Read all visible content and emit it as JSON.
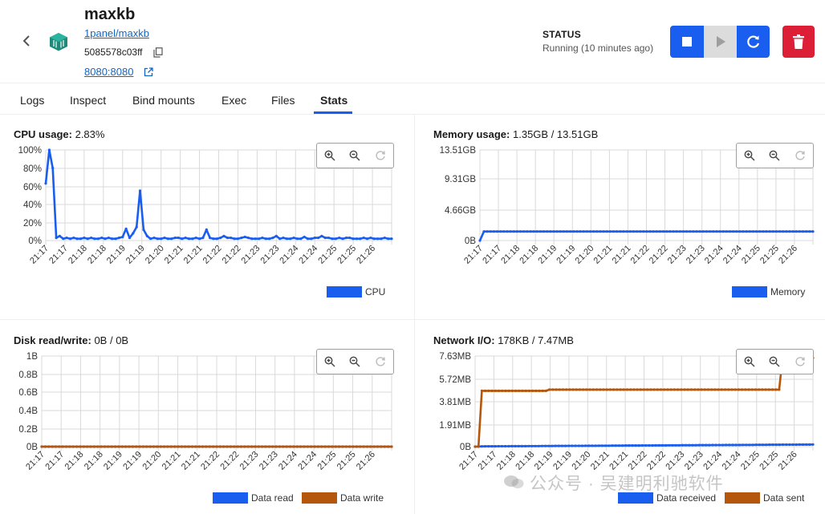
{
  "header": {
    "name": "maxkb",
    "image": "1panel/maxkb",
    "container_id": "5085578c03ff",
    "port": "8080:8080",
    "status_label": "STATUS",
    "status_value": "Running (10 minutes ago)"
  },
  "tabs": [
    {
      "label": "Logs",
      "active": false
    },
    {
      "label": "Inspect",
      "active": false
    },
    {
      "label": "Bind mounts",
      "active": false
    },
    {
      "label": "Exec",
      "active": false
    },
    {
      "label": "Files",
      "active": false
    },
    {
      "label": "Stats",
      "active": true
    }
  ],
  "colors": {
    "blue": "#1a5ef0",
    "orange": "#b5560d",
    "red": "#dc1e36",
    "grid": "#d9d9d9"
  },
  "panels": {
    "cpu": {
      "label": "CPU usage:",
      "value": "2.83%"
    },
    "memory": {
      "label": "Memory usage:",
      "value": "1.35GB / 13.51GB"
    },
    "disk": {
      "label": "Disk read/write:",
      "value": "0B / 0B"
    },
    "network": {
      "label": "Network I/O:",
      "value": "178KB / 7.47MB"
    }
  },
  "watermark": "公众号 · 吴建明利驰软件",
  "chart_data": [
    {
      "id": "cpu",
      "type": "line",
      "y_ticks": [
        "100%",
        "80%",
        "60%",
        "40%",
        "20%",
        "0%"
      ],
      "ylim": [
        0,
        100
      ],
      "x_ticks": [
        "21:17",
        "21:17",
        "21:18",
        "21:18",
        "21:19",
        "21:19",
        "21:20",
        "21:21",
        "21:21",
        "21:22",
        "21:22",
        "21:23",
        "21:23",
        "21:24",
        "21:24",
        "21:25",
        "21:25",
        "21:26"
      ],
      "series": [
        {
          "name": "CPU",
          "color": "#1a5ef0",
          "values": [
            63,
            100,
            80,
            3,
            5,
            2,
            3,
            2,
            3,
            2,
            2,
            3,
            2,
            3,
            2,
            2,
            3,
            2,
            3,
            2,
            2,
            3,
            4,
            13,
            3,
            8,
            15,
            55,
            12,
            5,
            2,
            3,
            2,
            2,
            3,
            2,
            2,
            3,
            3,
            2,
            3,
            2,
            2,
            3,
            2,
            3,
            12,
            3,
            2,
            2,
            3,
            5,
            3,
            3,
            2,
            2,
            3,
            4,
            3,
            2,
            2,
            2,
            3,
            2,
            2,
            3,
            5,
            2,
            3,
            2,
            2,
            3,
            2,
            2,
            4,
            2,
            2,
            3,
            3,
            5,
            3,
            3,
            2,
            2,
            3,
            2,
            3,
            3,
            2,
            2,
            2,
            3,
            2,
            3,
            2,
            2,
            2,
            3,
            2,
            2
          ]
        }
      ]
    },
    {
      "id": "memory",
      "type": "line",
      "y_ticks": [
        "13.51GB",
        "9.31GB",
        "4.66GB",
        "0B"
      ],
      "ylim": [
        0,
        13.51
      ],
      "x_ticks": [
        "21:17",
        "21:17",
        "21:18",
        "21:18",
        "21:19",
        "21:19",
        "21:20",
        "21:21",
        "21:21",
        "21:22",
        "21:22",
        "21:23",
        "21:23",
        "21:24",
        "21:24",
        "21:25",
        "21:25",
        "21:26"
      ],
      "series": [
        {
          "name": "Memory",
          "color": "#1a5ef0",
          "constant_after_start": 1.35,
          "start": 0
        }
      ]
    },
    {
      "id": "disk",
      "type": "line",
      "y_ticks": [
        "1B",
        "0.8B",
        "0.6B",
        "0.4B",
        "0.2B",
        "0B"
      ],
      "ylim": [
        0,
        1
      ],
      "x_ticks": [
        "21:17",
        "21:17",
        "21:18",
        "21:18",
        "21:19",
        "21:19",
        "21:20",
        "21:21",
        "21:21",
        "21:22",
        "21:22",
        "21:23",
        "21:23",
        "21:24",
        "21:24",
        "21:25",
        "21:25",
        "21:26"
      ],
      "series": [
        {
          "name": "Data read",
          "color": "#1a5ef0",
          "constant": 0
        },
        {
          "name": "Data write",
          "color": "#b5560d",
          "constant": 0
        }
      ]
    },
    {
      "id": "network",
      "type": "line",
      "y_ticks": [
        "7.63MB",
        "5.72MB",
        "3.81MB",
        "1.91MB",
        "0B"
      ],
      "ylim": [
        0,
        7.63
      ],
      "x_ticks": [
        "21:17",
        "21:17",
        "21:18",
        "21:18",
        "21:19",
        "21:19",
        "21:20",
        "21:21",
        "21:21",
        "21:22",
        "21:22",
        "21:23",
        "21:23",
        "21:24",
        "21:24",
        "21:25",
        "21:25",
        "21:26"
      ],
      "series": [
        {
          "name": "Data received",
          "color": "#1a5ef0",
          "start": 0,
          "steady": [
            0.02,
            0.18
          ]
        },
        {
          "name": "Data sent",
          "color": "#b5560d",
          "levels": [
            [
              0,
              0
            ],
            [
              0.02,
              4.7
            ],
            [
              0.22,
              4.8
            ],
            [
              0.91,
              7.47
            ]
          ]
        }
      ]
    }
  ]
}
